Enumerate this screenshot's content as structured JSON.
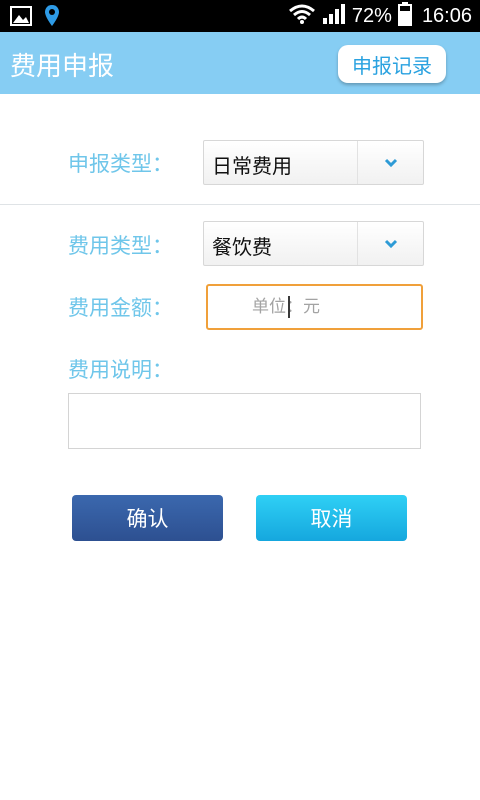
{
  "status_bar": {
    "battery": "72%",
    "time": "16:06",
    "icons": [
      "gallery-icon",
      "location-pin-icon",
      "wifi-icon",
      "signal-icon",
      "battery-icon"
    ]
  },
  "header": {
    "title": "费用申报",
    "records_button": "申报记录",
    "background_color": "#86cdf3"
  },
  "form": {
    "report_type": {
      "label": "申报类型：",
      "selected": "日常费用"
    },
    "expense_type": {
      "label": "费用类型：",
      "selected": "餐饮费"
    },
    "amount": {
      "label": "费用金额：",
      "placeholder": "单位：元",
      "value": ""
    },
    "description": {
      "label": "费用说明：",
      "value": ""
    }
  },
  "actions": {
    "confirm": "确认",
    "cancel": "取消"
  },
  "colors": {
    "label": "#6fc6ea",
    "confirm": "#3260a3",
    "cancel": "#1fbbe9",
    "focus_border": "#f0a03a"
  }
}
